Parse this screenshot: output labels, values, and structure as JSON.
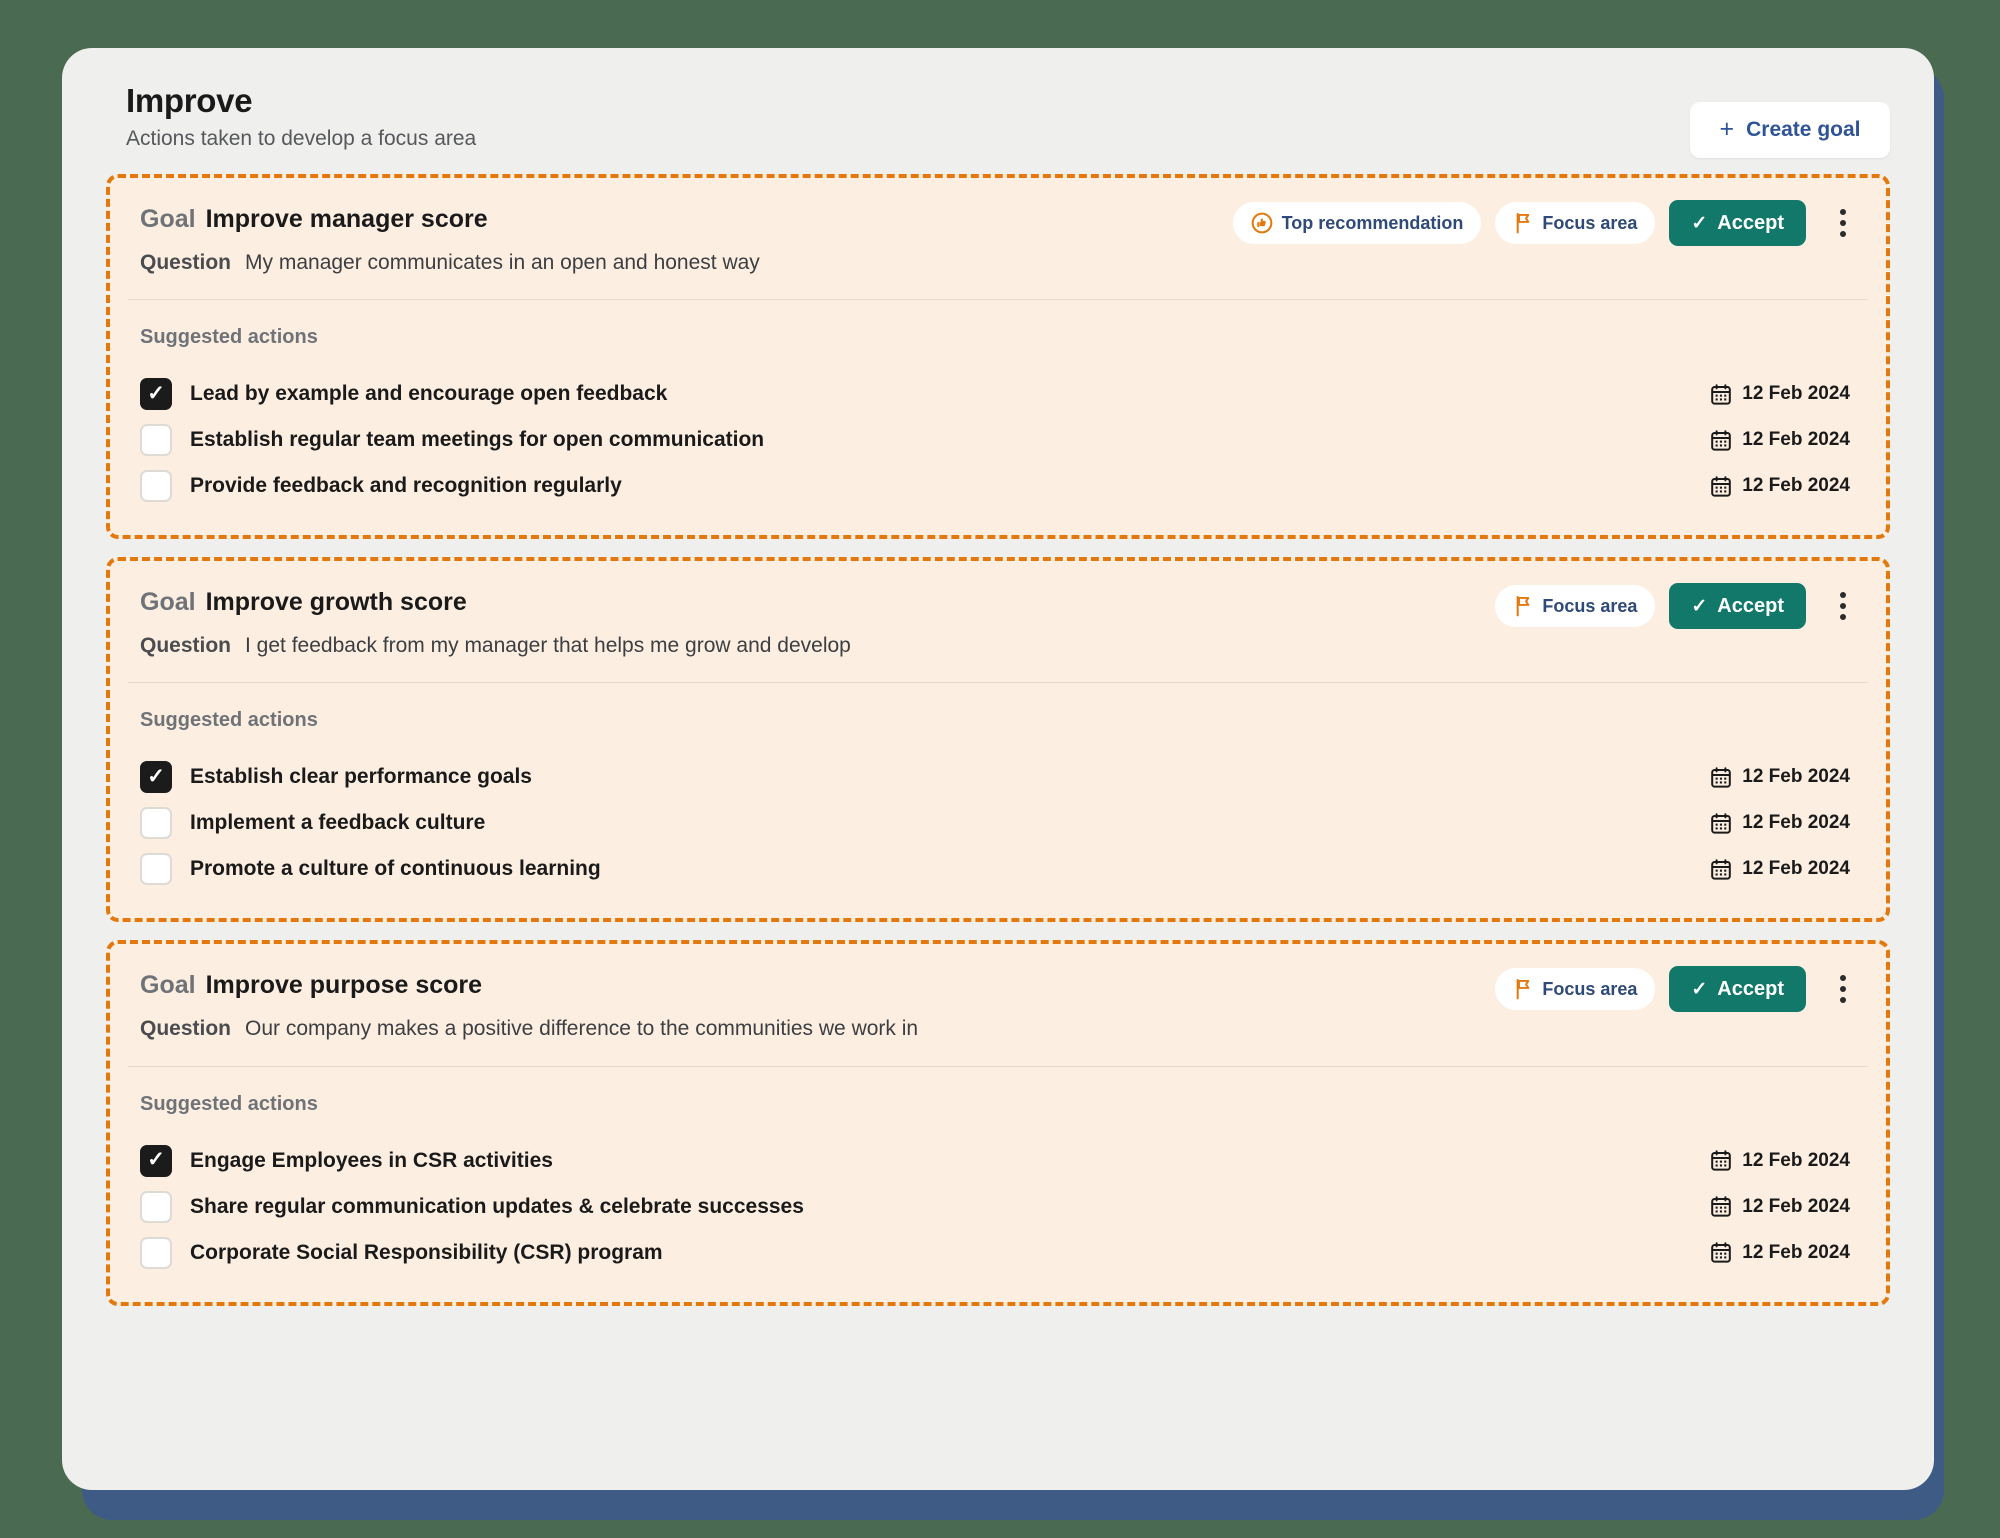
{
  "header": {
    "title": "Improve",
    "subtitle": "Actions taken to develop a focus area",
    "create_goal_label": "Create goal",
    "create_goal_plus": "+"
  },
  "labels": {
    "goal_label": "Goal",
    "question_label": "Question",
    "suggested_actions_label": "Suggested actions",
    "accept_label": "Accept",
    "accept_tick": "✓",
    "check_mark": "✓",
    "top_recommendation_label": "Top recommendation",
    "focus_area_label": "Focus area"
  },
  "colors": {
    "page_background": "#4a6b51",
    "panel_background": "#efefed",
    "shadow_plate": "#3d5b85",
    "card_background": "#fcefe2",
    "card_border": "#e3790e",
    "accent_orange": "#e3790e",
    "accept_green": "#11786a",
    "link_blue": "#2f5496",
    "pill_text": "#2f4a78"
  },
  "goals": [
    {
      "goal_label": "Goal",
      "name": "Improve manager score",
      "question_label": "Question",
      "question": "My manager communicates in an open and honest way",
      "top_recommendation": true,
      "top_recommendation_label": "Top recommendation",
      "focus_area_label": "Focus area",
      "accept_label": "Accept",
      "suggested_actions_label": "Suggested actions",
      "actions": [
        {
          "text": "Lead by example and encourage open feedback",
          "checked": true,
          "date": "12 Feb 2024"
        },
        {
          "text": "Establish regular team meetings for open communication",
          "checked": false,
          "date": "12 Feb 2024"
        },
        {
          "text": "Provide feedback and recognition regularly",
          "checked": false,
          "date": "12 Feb 2024"
        }
      ]
    },
    {
      "goal_label": "Goal",
      "name": "Improve growth score",
      "question_label": "Question",
      "question": "I get feedback from my manager that helps me grow and develop",
      "top_recommendation": false,
      "top_recommendation_label": "Top recommendation",
      "focus_area_label": "Focus area",
      "accept_label": "Accept",
      "suggested_actions_label": "Suggested actions",
      "actions": [
        {
          "text": "Establish clear performance goals",
          "checked": true,
          "date": "12 Feb 2024"
        },
        {
          "text": "Implement a feedback culture",
          "checked": false,
          "date": "12 Feb 2024"
        },
        {
          "text": "Promote a culture of continuous learning",
          "checked": false,
          "date": "12 Feb 2024"
        }
      ]
    },
    {
      "goal_label": "Goal",
      "name": "Improve purpose score",
      "question_label": "Question",
      "question": "Our company makes a positive difference to the communities we work in",
      "top_recommendation": false,
      "top_recommendation_label": "Top recommendation",
      "focus_area_label": "Focus area",
      "accept_label": "Accept",
      "suggested_actions_label": "Suggested actions",
      "actions": [
        {
          "text": "Engage Employees in CSR activities",
          "checked": true,
          "date": "12 Feb 2024"
        },
        {
          "text": "Share regular communication updates & celebrate successes",
          "checked": false,
          "date": "12 Feb 2024"
        },
        {
          "text": "Corporate Social Responsibility (CSR) program",
          "checked": false,
          "date": "12 Feb 2024"
        }
      ]
    }
  ]
}
